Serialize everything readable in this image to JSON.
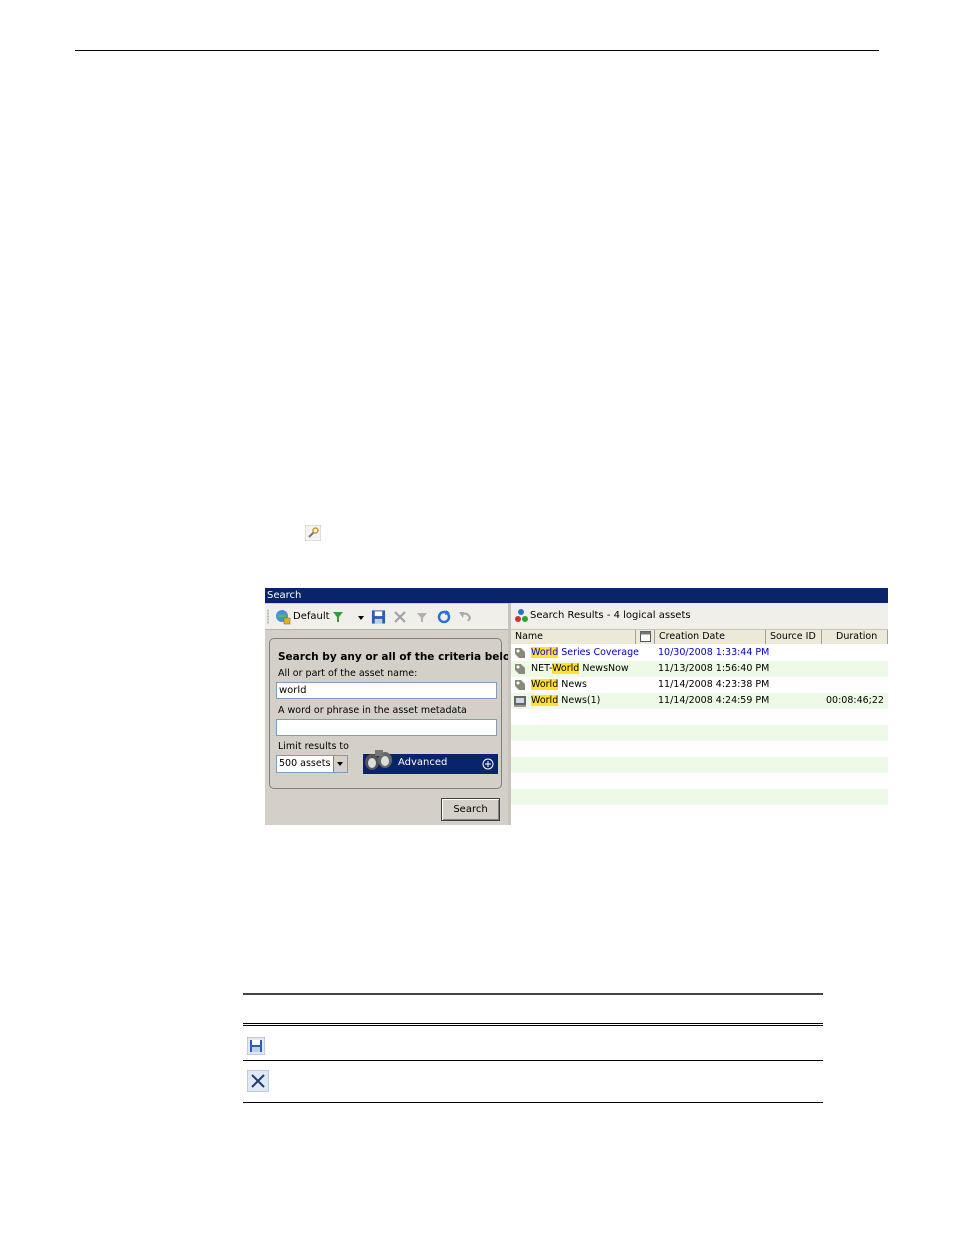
{
  "window": {
    "title": "Search"
  },
  "toolbar": {
    "view_label": "Default"
  },
  "criteria": {
    "heading": "Search by any or all of the criteria below.",
    "name_label": "All or part of the asset name:",
    "name_value": "world",
    "metadata_label": "A word or phrase in the asset metadata",
    "metadata_value": "",
    "limit_label": "Limit results to",
    "limit_value": "500 assets",
    "advanced_label": "Advanced",
    "search_button": "Search"
  },
  "results": {
    "title": "Search Results - 4 logical assets",
    "columns": [
      "Name",
      "",
      "Creation Date",
      "Source ID",
      "Duration"
    ],
    "rows": [
      {
        "name_hl": "World",
        "name_rest": " Series Coverage",
        "name_pre": "",
        "date": "10/30/2008 1:33:44 PM",
        "source_id": "",
        "duration": "",
        "selected": true
      },
      {
        "name_pre": "NET-",
        "name_hl": "World",
        "name_rest": " NewsNow",
        "date": "11/13/2008 1:56:40 PM",
        "source_id": "",
        "duration": ""
      },
      {
        "name_pre": "",
        "name_hl": "World",
        "name_rest": " News",
        "date": "11/14/2008 4:23:38 PM",
        "source_id": "",
        "duration": ""
      },
      {
        "name_pre": "",
        "name_hl": "World",
        "name_rest": " News(1)",
        "date": "11/14/2008 4:24:59 PM",
        "source_id": "",
        "duration": "00:08:46;22"
      }
    ]
  },
  "colors": {
    "titlebar": "#0a246a",
    "highlight": "#ffe033",
    "row_alt": "#eefae6"
  }
}
